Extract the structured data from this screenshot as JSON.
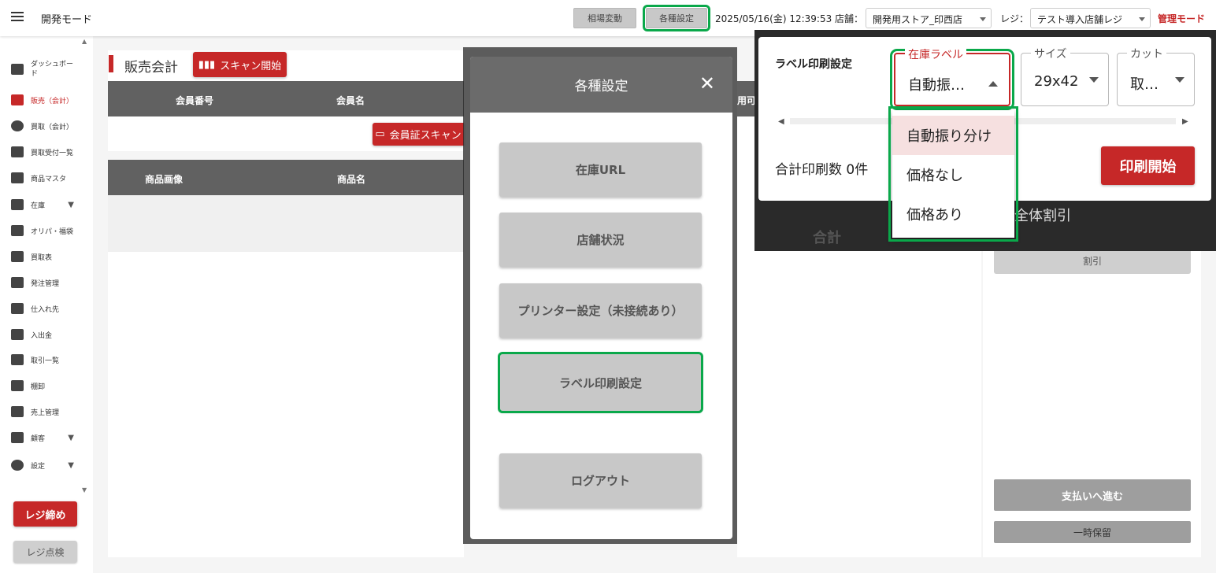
{
  "topbar": {
    "app_title": "開発モード",
    "market_change_label": "相場変動",
    "settings_label": "各種設定",
    "datetime": "2025/05/16(金) 12:39:53",
    "store_label": "店舗：",
    "store_value": "開発用ストア_印西店",
    "register_label": "レジ：",
    "register_value": "テスト導入店舗レジ",
    "admin_mode": "管理モード"
  },
  "sidebar": {
    "items": [
      {
        "label": "ダッシュボード",
        "icon": "dashboard-icon"
      },
      {
        "label": "販売（会計）",
        "icon": "cart-icon",
        "active": true
      },
      {
        "label": "買取（会計）",
        "icon": "dollar-icon"
      },
      {
        "label": "買取受付一覧",
        "icon": "receipt-icon"
      },
      {
        "label": "商品マスタ",
        "icon": "store-icon"
      },
      {
        "label": "在庫",
        "icon": "archive-icon",
        "expandable": true
      },
      {
        "label": "オリパ・福袋",
        "icon": "gift-icon"
      },
      {
        "label": "買取表",
        "icon": "list-icon"
      },
      {
        "label": "発注管理",
        "icon": "truck-icon"
      },
      {
        "label": "仕入れ先",
        "icon": "warehouse-icon"
      },
      {
        "label": "入出金",
        "icon": "cash-register-icon"
      },
      {
        "label": "取引一覧",
        "icon": "transfer-icon"
      },
      {
        "label": "棚卸",
        "icon": "clipboard-check-icon"
      },
      {
        "label": "売上管理",
        "icon": "bar-chart-icon"
      },
      {
        "label": "顧客",
        "icon": "people-icon",
        "expandable": true
      },
      {
        "label": "設定",
        "icon": "gear-icon",
        "expandable": true
      }
    ],
    "close_register": "レジ締め",
    "check_register": "レジ点検"
  },
  "sales": {
    "title": "販売会計",
    "scan_start": "スキャン開始",
    "member_headers": [
      "会員番号",
      "会員名",
      "用可"
    ],
    "member_card_scan": "会員証スキャン",
    "product_headers": [
      "商品画像",
      "商品名"
    ],
    "total_label": "合計",
    "overall_discount": "全体割引",
    "discount_button": "割引",
    "proceed_payment": "支払いへ進む",
    "hold": "一時保留"
  },
  "settings_modal": {
    "title": "各種設定",
    "buttons": [
      "在庫URL",
      "店舗状況",
      "プリンター設定（未接続あり）",
      "ラベル印刷設定",
      "ログアウト"
    ]
  },
  "label_print": {
    "title": "ラベル印刷設定",
    "stock_label_field": "在庫ラベル",
    "stock_label_value": "自動振…",
    "size_field": "サイズ",
    "size_value": "29x42",
    "cut_field": "カット",
    "cut_value": "取…",
    "total_count": "合計印刷数 0件",
    "print_start": "印刷開始",
    "options": [
      "自動振り分け",
      "価格なし",
      "価格あり"
    ]
  },
  "colors": {
    "accent": "#c62828",
    "highlight": "#0aa84a",
    "header": "#616161"
  }
}
